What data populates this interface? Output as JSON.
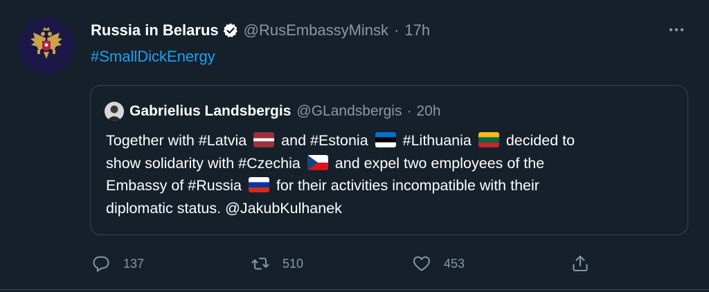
{
  "tweet": {
    "author_name": "Russia in Belarus",
    "handle": "@RusEmbassyMinsk",
    "separator": "·",
    "time": "17h",
    "text": "#SmallDickEnergy"
  },
  "quoted": {
    "author_name": "Gabrielius Landsbergis",
    "handle": "@GLandsbergis",
    "separator": "·",
    "time": "20h",
    "lines": [
      {
        "a": "Together with #Latvia",
        "b": "and #Estonia",
        "c": "#Lithuania",
        "d": "decided to"
      },
      {
        "a": "show solidarity with #Czechia",
        "b": "and expel two employees of the"
      },
      {
        "a": "Embassy of #Russia",
        "b": "for their activities incompatible with their"
      },
      {
        "a": "diplomatic status. @JakubKulhanek"
      }
    ]
  },
  "actions": {
    "replies": "137",
    "retweets": "510",
    "likes": "453"
  },
  "icons": {
    "verified": "verified-badge-icon",
    "more": "more-dots-icon",
    "reply": "reply-icon",
    "retweet": "retweet-icon",
    "like": "heart-icon",
    "share": "share-icon"
  },
  "colors": {
    "background": "#15202b",
    "link": "#1da1f2",
    "muted": "#8899a6",
    "border": "#38444d"
  }
}
